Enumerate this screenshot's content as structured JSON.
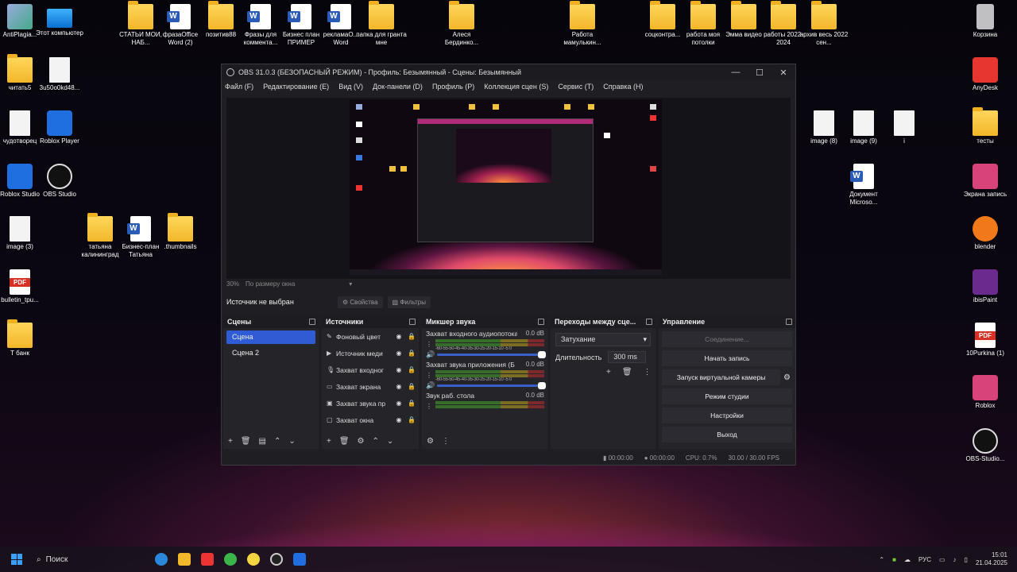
{
  "desktop": {
    "icons": [
      {
        "label": "AntiPlagia...",
        "kind": "anti"
      },
      {
        "label": "Этот компьютер",
        "kind": "pc"
      },
      {
        "label": "СТАТЬИ МОИ, НАБ...",
        "kind": "folder"
      },
      {
        "label": "фразаOffice Word (2)",
        "kind": "word"
      },
      {
        "label": "позитив88",
        "kind": "folder"
      },
      {
        "label": "Фразы для коммента...",
        "kind": "word"
      },
      {
        "label": "Бизнес план ПРИМЕР",
        "kind": "word"
      },
      {
        "label": "рекламаО... Word",
        "kind": "word"
      },
      {
        "label": "папка для гранта мне",
        "kind": "folder"
      },
      {
        "label": "Алеся Бердинко...",
        "kind": "folder"
      },
      {
        "label": "Работа мамулькин...",
        "kind": "folder"
      },
      {
        "label": "соцконтра...",
        "kind": "folder"
      },
      {
        "label": "работа моя потолки",
        "kind": "folder"
      },
      {
        "label": "Эмма видео",
        "kind": "folder"
      },
      {
        "label": "работы 2022-2024",
        "kind": "folder"
      },
      {
        "label": "архив весь 2022 сен...",
        "kind": "folder"
      },
      {
        "label": "Корзина",
        "kind": "recycle"
      },
      {
        "label": "читать5",
        "kind": "folder"
      },
      {
        "label": "3u50o0kd48...",
        "kind": "doc"
      },
      {
        "label": "AnyDesk",
        "kind": "red"
      },
      {
        "label": "чудотворец",
        "kind": "doc"
      },
      {
        "label": "Roblox Player",
        "kind": "blue"
      },
      {
        "label": "image (8)",
        "kind": "doc"
      },
      {
        "label": "image (9)",
        "kind": "doc"
      },
      {
        "label": "i",
        "kind": "doc"
      },
      {
        "label": "тесты",
        "kind": "folder"
      },
      {
        "label": "Roblox Studio",
        "kind": "blue"
      },
      {
        "label": "OBS Studio",
        "kind": "obs"
      },
      {
        "label": "Документ Microso...",
        "kind": "word"
      },
      {
        "label": "Экрана запись",
        "kind": "pink"
      },
      {
        "label": "image (3)",
        "kind": "doc"
      },
      {
        "label": "татьяна калининград",
        "kind": "folder"
      },
      {
        "label": "Бизнес-план Татьяна",
        "kind": "word"
      },
      {
        "label": ".thumbnails",
        "kind": "folder"
      },
      {
        "label": "blender",
        "kind": "blender"
      },
      {
        "label": "bulletin_tpu...",
        "kind": "pdf"
      },
      {
        "label": "ibisPaint",
        "kind": "purple"
      },
      {
        "label": "10Purkina (1)",
        "kind": "pdf"
      },
      {
        "label": "Т банк",
        "kind": "folder"
      },
      {
        "label": "Roblox",
        "kind": "pink"
      },
      {
        "label": "OBS-Studio...",
        "kind": "obs"
      }
    ]
  },
  "obs": {
    "title": "OBS 31.0.3 (БЕЗОПАСНЫЙ РЕЖИМ) - Профиль: Безымянный - Сцены: Безымянный",
    "menu": [
      "Файл (F)",
      "Редактирование (E)",
      "Вид (V)",
      "Док-панели (D)",
      "Профиль (P)",
      "Коллекция сцен (S)",
      "Сервис (T)",
      "Справка (H)"
    ],
    "zoom_percent": "30%",
    "zoom_mode": "По размеру окна",
    "no_source": "Источник не выбран",
    "properties": "Свойства",
    "filters": "Фильтры",
    "docks": {
      "scenes": "Сцены",
      "sources": "Источники",
      "mixer": "Микшер звука",
      "transitions": "Переходы между сце...",
      "controls": "Управление"
    },
    "scenes": [
      "Сцена",
      "Сцена 2"
    ],
    "sources": [
      {
        "name": "Фоновый цвет",
        "icon": "brush-icon"
      },
      {
        "name": "Источник меди",
        "icon": "play-icon"
      },
      {
        "name": "Захват входног",
        "icon": "mic-icon"
      },
      {
        "name": "Захват экрана",
        "icon": "monitor-icon"
      },
      {
        "name": "Захват звука пр",
        "icon": "app-audio-icon"
      },
      {
        "name": "Захват окна",
        "icon": "window-icon"
      }
    ],
    "mixer": [
      {
        "name": "Захват входного аудиопотока",
        "db": "0.0 dB",
        "ticks": "-60-55-50-45-40-35-30-25-20-15-10 -5  0"
      },
      {
        "name": "Захват звука приложения (Б",
        "db": "0.0 dB",
        "ticks": "-60-55-50-45-40-35-30-25-20-15-10 -5  0"
      },
      {
        "name": "Звук раб. стола",
        "db": "0.0 dB",
        "ticks": ""
      }
    ],
    "transition": "Затухание",
    "duration_label": "Длительность",
    "duration_value": "300 ms",
    "controls": {
      "connect": "Соединение...",
      "record": "Начать запись",
      "virtual_cam": "Запуск виртуальной камеры",
      "studio": "Режим студии",
      "settings": "Настройки",
      "exit": "Выход"
    },
    "status": {
      "stream_time": "00:00:00",
      "rec_time": "00:00:00",
      "cpu": "CPU: 0.7%",
      "fps": "30.00 / 30.00 FPS"
    }
  },
  "taskbar": {
    "search": "Поиск",
    "lang": "РУС",
    "time": "15:01",
    "date": "21.04.2025"
  }
}
